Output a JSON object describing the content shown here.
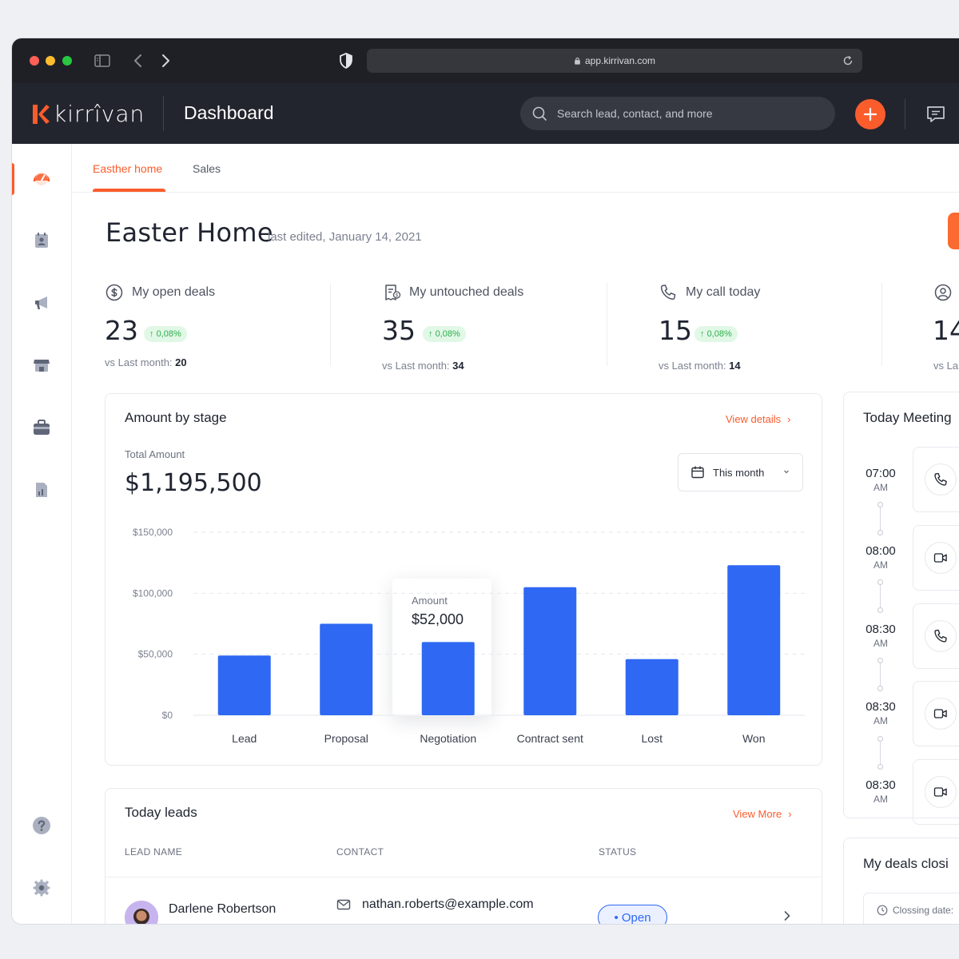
{
  "browser": {
    "url": "app.kirrivan.com"
  },
  "app": {
    "logo_text": "kirrîvan",
    "title": "Dashboard",
    "search_placeholder": "Search lead, contact, and more",
    "accent": "#fb5c2c",
    "bar_color": "#2f68f2"
  },
  "tabs": [
    {
      "label": "Easther home",
      "active": true
    },
    {
      "label": "Sales",
      "active": false
    }
  ],
  "page": {
    "title": "Easter Home",
    "subtitle": "last edited, January 14, 2021"
  },
  "stats": [
    {
      "label": "My open deals",
      "value": "23",
      "change": "0,08%",
      "foot_label": "vs Last month:",
      "foot_value": "20",
      "icon": "dollar-circle-icon"
    },
    {
      "label": "My untouched deals",
      "value": "35",
      "change": "0,08%",
      "foot_label": "vs Last month:",
      "foot_value": "34",
      "icon": "invoice-icon"
    },
    {
      "label": "My call today",
      "value": "15",
      "change": "0,08%",
      "foot_label": "vs Last month:",
      "foot_value": "14",
      "icon": "phone-icon"
    },
    {
      "value": "14",
      "foot_label": "vs La",
      "icon": "user-circle-icon"
    }
  ],
  "amount_card": {
    "title": "Amount by stage",
    "link": "View details",
    "total_label": "Total Amount",
    "total_value": "$1,195,500",
    "period": "This month",
    "tooltip_label": "Amount",
    "tooltip_value": "$52,000"
  },
  "chart_data": {
    "type": "bar",
    "title": "Amount by stage",
    "categories": [
      "Lead",
      "Proposal",
      "Negotiation",
      "Contract sent",
      "Lost",
      "Won"
    ],
    "values": [
      49000,
      75000,
      60000,
      105000,
      46000,
      123000
    ],
    "ylim": [
      0,
      150000
    ],
    "yticks": [
      0,
      50000,
      100000,
      150000
    ],
    "ytick_labels": [
      "$0",
      "$50,000",
      "$100,000",
      "$150,000"
    ],
    "highlight_index": 2,
    "grid": true
  },
  "leads_card": {
    "title": "Today leads",
    "link": "View More",
    "columns": [
      "LEAD NAME",
      "CONTACT",
      "STATUS"
    ],
    "rows": [
      {
        "name": "Darlene Robertson",
        "email": "nathan.roberts@example.com",
        "status": "• Open"
      }
    ]
  },
  "meetings": {
    "title": "Today Meeting",
    "items": [
      {
        "time": "07:00",
        "ampm": "AM",
        "type": "phone-icon"
      },
      {
        "time": "08:00",
        "ampm": "AM",
        "type": "video-icon"
      },
      {
        "time": "08:30",
        "ampm": "AM",
        "type": "phone-icon"
      },
      {
        "time": "08:30",
        "ampm": "AM",
        "type": "video-icon"
      },
      {
        "time": "08:30",
        "ampm": "AM",
        "type": "video-icon"
      }
    ]
  },
  "deals_closing": {
    "title": "My deals closi",
    "closing_label": "Clossing date:"
  }
}
